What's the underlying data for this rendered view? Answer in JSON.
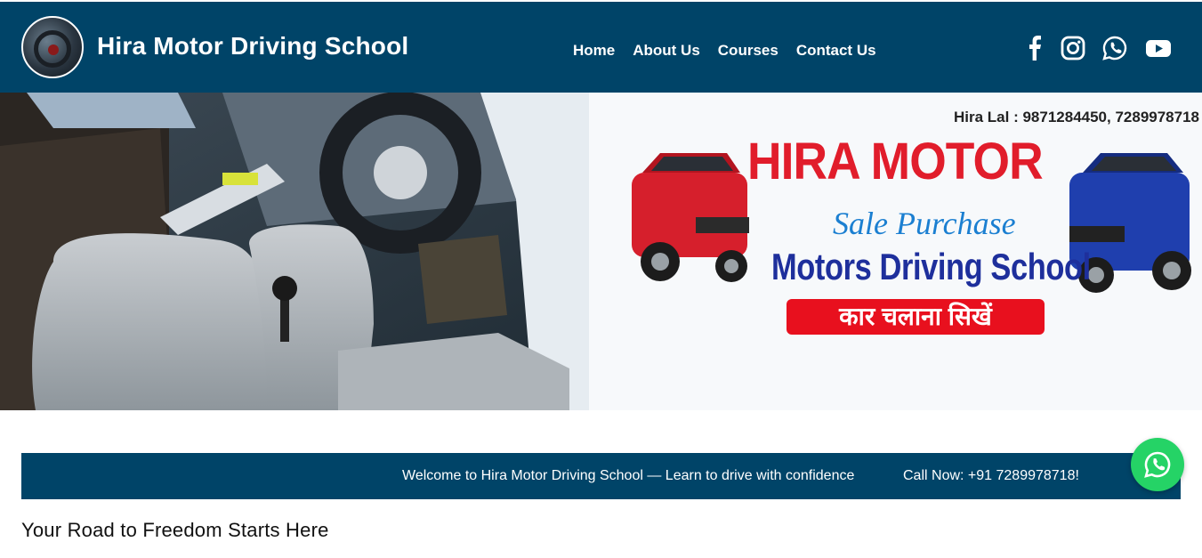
{
  "header": {
    "brand": "Hira Motor Driving School",
    "nav": [
      "Home",
      "About Us",
      "Courses",
      "Contact Us"
    ],
    "social": [
      "facebook-icon",
      "instagram-icon",
      "whatsapp-icon",
      "youtube-icon"
    ]
  },
  "hero": {
    "banner": {
      "contact": "Hira Lal : 9871284450, 7289978718",
      "title": "HIRA MOTOR",
      "subtitle": "Sale Purchase",
      "school": "Motors Driving School",
      "tagline": "कार चलाना सिखें"
    }
  },
  "ticker": {
    "welcome": "Welcome to Hira Motor Driving School — Learn to drive with confidence",
    "call": "Call Now: +91 7289978718!"
  },
  "section": {
    "heading": "Your Road to Freedom Starts Here"
  },
  "colors": {
    "header_bg": "#004468",
    "accent_red": "#e11d2b",
    "whatsapp": "#25d366"
  }
}
